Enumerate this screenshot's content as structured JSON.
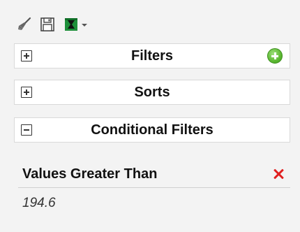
{
  "toolbar": {
    "clear_icon": "broom-icon",
    "save_icon": "floppy-disk-icon",
    "export_icon": "excel-export-icon"
  },
  "panels": {
    "filters": {
      "title": "Filters",
      "expanded": false
    },
    "sorts": {
      "title": "Sorts",
      "expanded": false
    },
    "conditional_filters": {
      "title": "Conditional Filters",
      "expanded": true
    }
  },
  "condition": {
    "label": "Values Greater Than",
    "value": "194.6"
  },
  "colors": {
    "background": "#f3f3f3",
    "panel": "#ffffff",
    "add_button": "#5cb832",
    "remove_icon": "#e02020",
    "excel_green": "#1e8f3a"
  }
}
